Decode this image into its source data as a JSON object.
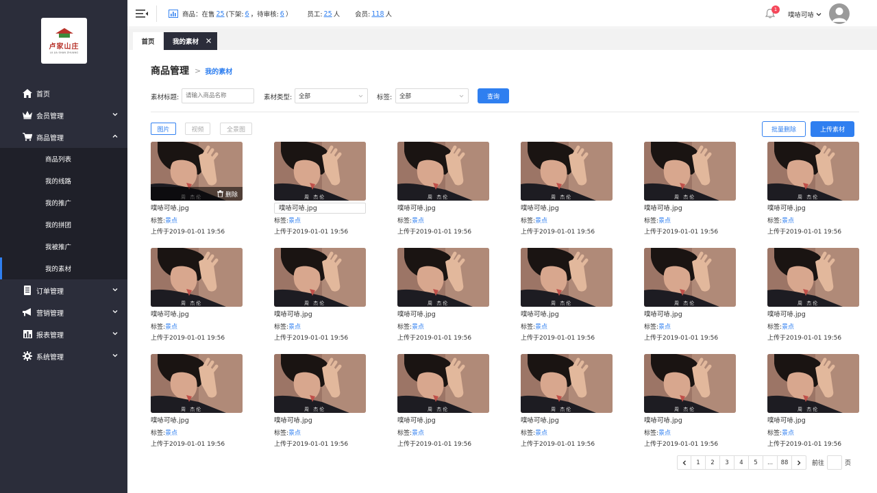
{
  "logo": {
    "cn": "卢家山庄",
    "en": "LU JIA SHAN ZHUANG"
  },
  "sidebar": {
    "items": [
      {
        "label": "首页",
        "icon": "home-icon"
      },
      {
        "label": "会员管理",
        "icon": "crown-icon"
      },
      {
        "label": "商品管理",
        "icon": "cart-icon",
        "expanded": true,
        "children": [
          "商品列表",
          "我的线路",
          "我的推广",
          "我的拼团",
          "我被推广",
          "我的素材"
        ]
      },
      {
        "label": "订单管理",
        "icon": "document-icon"
      },
      {
        "label": "营销管理",
        "icon": "megaphone-icon"
      },
      {
        "label": "报表管理",
        "icon": "bar-chart-icon"
      },
      {
        "label": "系统管理",
        "icon": "gear-icon"
      }
    ],
    "active_child": "我的素材"
  },
  "topbar": {
    "goods_label": "商品：在售",
    "on_sale": "25",
    "off_label": "(下架:",
    "off": "6",
    "pending_label": "，待审核:",
    "pending": "6",
    "close_paren": "）",
    "staff_label": "员工:",
    "staff": "25",
    "staff_unit": "人",
    "member_label": "会员:",
    "members": "118",
    "member_unit": "人",
    "notifications": "1",
    "username": "噗哧可哧"
  },
  "tabs": {
    "home": "首页",
    "current": "我的素材"
  },
  "page": {
    "title": "商品管理",
    "breadcrumb": "我的素材"
  },
  "filters": {
    "title_label": "素材标题:",
    "title_placeholder": "请输入商品名称",
    "type_label": "素材类型:",
    "type_value": "全部",
    "tag_label": "标签:",
    "tag_value": "全部",
    "query_button": "查询"
  },
  "type_tabs": [
    "图片",
    "视频",
    "全景图"
  ],
  "actions": {
    "batch_delete": "批量删除",
    "upload": "上传素材"
  },
  "card_template": {
    "name": "噗哧可哧.jpg",
    "tag_label": "标签:",
    "tag_value": "景点",
    "uploaded": "上传于2019-01-01 19:56",
    "watermark": "周 杰伦",
    "delete_label": "删除"
  },
  "card_count": 18,
  "pagination": {
    "pages": [
      "1",
      "2",
      "3",
      "4",
      "5",
      "...",
      "88"
    ],
    "goto_label": "前往",
    "page_unit": "页"
  },
  "colors": {
    "accent": "#2f7ff0",
    "sidebar": "#2b2d3a",
    "badge": "#f5475a"
  }
}
